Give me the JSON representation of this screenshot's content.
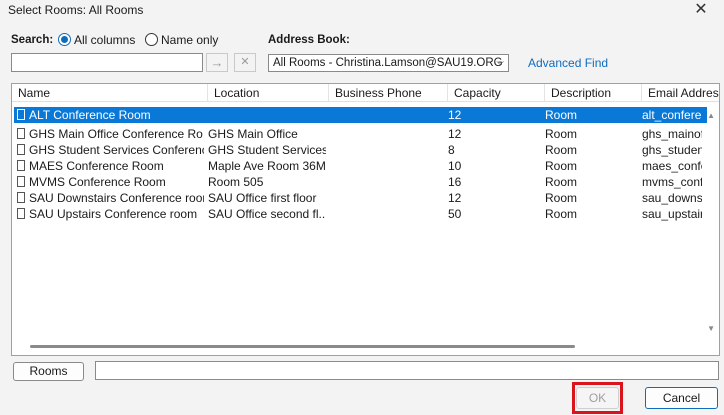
{
  "window": {
    "title": "Select Rooms: All Rooms",
    "close_glyph": "✕"
  },
  "search": {
    "label": "Search:",
    "radio_all": "All columns",
    "radio_name": "Name only",
    "value": "",
    "go_glyph": "→",
    "clear_glyph": "✕"
  },
  "address_book": {
    "label": "Address Book:",
    "value": "All Rooms - Christina.Lamson@SAU19.ORG",
    "chevron": "⌵"
  },
  "advanced_find": "Advanced Find",
  "columns": [
    "Name",
    "Location",
    "Business Phone",
    "Capacity",
    "Description",
    "Email Address"
  ],
  "rows": [
    {
      "name": "ALT Conference Room",
      "location": "",
      "phone": "",
      "capacity": "12",
      "description": "Room",
      "email": "alt_conference"
    },
    {
      "name": "GHS Main Office Conference Ro...",
      "location": "GHS Main Office",
      "phone": "",
      "capacity": "12",
      "description": "Room",
      "email": "ghs_mainoffi"
    },
    {
      "name": "GHS Student Services Conferenc...",
      "location": "GHS Student Services",
      "phone": "",
      "capacity": "8",
      "description": "Room",
      "email": "ghs_studentse"
    },
    {
      "name": "MAES Conference Room",
      "location": "Maple Ave Room 36M",
      "phone": "",
      "capacity": "10",
      "description": "Room",
      "email": "maes_confere"
    },
    {
      "name": "MVMS Conference Room",
      "location": "Room 505",
      "phone": "",
      "capacity": "16",
      "description": "Room",
      "email": "mvms_confere"
    },
    {
      "name": "SAU Downstairs Conference room",
      "location": "SAU Office first floor",
      "phone": "",
      "capacity": "12",
      "description": "Room",
      "email": "sau_downstair"
    },
    {
      "name": "SAU Upstairs Conference room",
      "location": "SAU Office second fl...",
      "phone": "",
      "capacity": "50",
      "description": "Room",
      "email": "sau_upstairs"
    }
  ],
  "selected_row": 0,
  "scroll": {
    "up": "▲",
    "down": "▼"
  },
  "rooms_button": "Rooms",
  "rooms_field": "",
  "ok_button": "OK",
  "cancel_button": "Cancel",
  "colors": {
    "accent": "#0f6cbd",
    "selection": "#0a78d7",
    "highlight": "#d9141c"
  }
}
